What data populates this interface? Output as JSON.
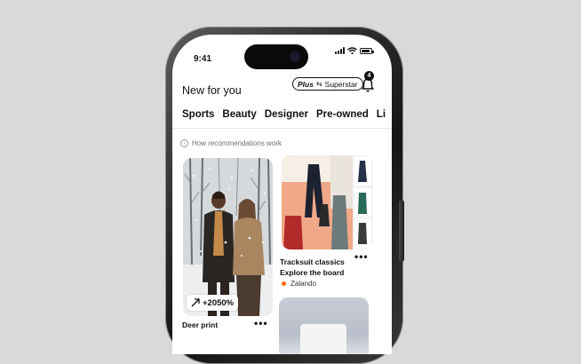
{
  "status_bar": {
    "time": "9:41"
  },
  "header": {
    "title": "New for you",
    "plus_label": "Plus",
    "superstar_label": "Superstar",
    "notification_count": "4",
    "bell_icon": "bell-icon"
  },
  "tabs": [
    {
      "label": "Sports"
    },
    {
      "label": "Beauty"
    },
    {
      "label": "Designer"
    },
    {
      "label": "Pre-owned"
    },
    {
      "label": "Li"
    }
  ],
  "recommendations_link": "How recommendations work",
  "pins": [
    {
      "title": "Deer print",
      "growth": "+2050%",
      "growth_icon": "trend-up-icon"
    },
    {
      "title_line1": "Tracksuit classics",
      "title_line2": "Explore the board",
      "brand": "Zalando"
    }
  ],
  "colors": {
    "brand_dot": "#ff6900",
    "background": "#d9d9d9",
    "screen": "#ffffff"
  }
}
